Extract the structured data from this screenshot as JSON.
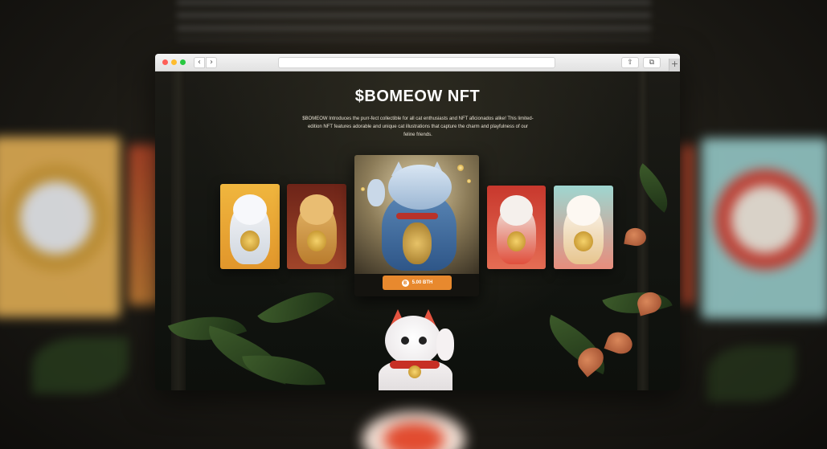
{
  "browser": {
    "back_icon": "‹",
    "forward_icon": "›",
    "share_icon": "⇧",
    "tabs_icon": "⧉",
    "new_tab_icon": "+"
  },
  "hero": {
    "title": "$BOMEOW NFT",
    "description": "$BOMEOW Introduces the purr-fect collectible for all cat enthusiasts and NFT aficionados alike! This limited-edition NFT features adorable and unique cat illustrations that capture the charm and playfulness of our feline friends."
  },
  "featured": {
    "price_label": "5.00 BTH",
    "coin_icon": "B"
  },
  "colors": {
    "accent": "#e8892e",
    "background": "#1a1813"
  },
  "icons": {
    "close": "close-dot-icon",
    "minimize": "minimize-dot-icon",
    "zoom": "zoom-dot-icon"
  }
}
